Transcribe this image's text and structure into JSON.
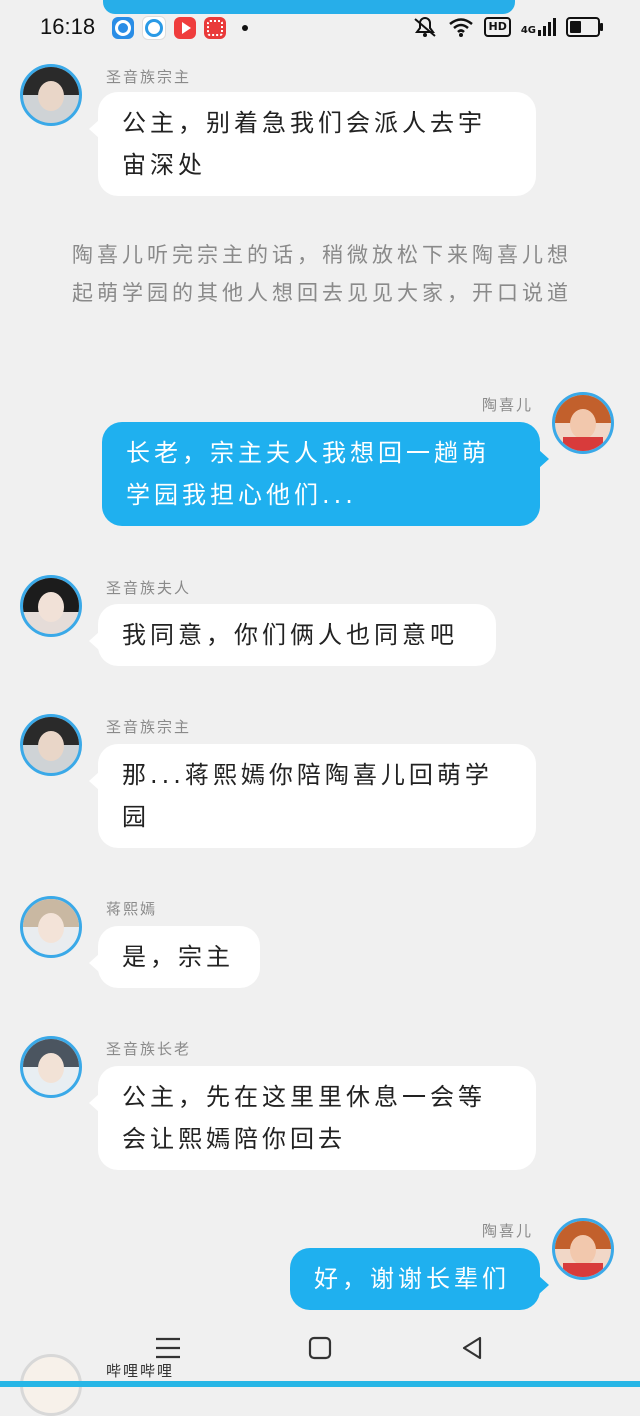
{
  "status": {
    "time": "16:18",
    "indicators": [
      "alarm-off-icon",
      "wifi-icon",
      "hd-icon",
      "4g-signal-icon",
      "battery-icon"
    ],
    "hd_label": "HD",
    "net_label": "4G"
  },
  "narration": "陶喜儿听完宗主的话，稍微放松下来陶喜儿想起萌学园的其他人想回去见见大家，开口说道",
  "messages": [
    {
      "sender": "圣音族宗主",
      "text": "公主，别着急我们会派人去宇宙深处",
      "mine": false
    },
    {
      "sender": "陶喜儿",
      "text": "长老，宗主夫人我想回一趟萌学园我担心他们...",
      "mine": true
    },
    {
      "sender": "圣音族夫人",
      "text": "我同意，你们俩人也同意吧",
      "mine": false
    },
    {
      "sender": "圣音族宗主",
      "text": "那...蒋熙嫣你陪陶喜儿回萌学园",
      "mine": false
    },
    {
      "sender": "蒋熙嫣",
      "text": "是，宗主",
      "mine": false
    },
    {
      "sender": "圣音族长老",
      "text": "公主，先在这里里休息一会等会让熙嫣陪你回去",
      "mine": false
    },
    {
      "sender": "陶喜儿",
      "text": "好，谢谢长辈们",
      "mine": true
    },
    {
      "sender": "哔哩哔哩",
      "text": "",
      "mine": false
    }
  ],
  "nav": [
    "menu-icon",
    "home-square-icon",
    "back-triangle-icon"
  ],
  "colors": {
    "accent": "#1fb0ef",
    "background": "#f0f0f0"
  }
}
